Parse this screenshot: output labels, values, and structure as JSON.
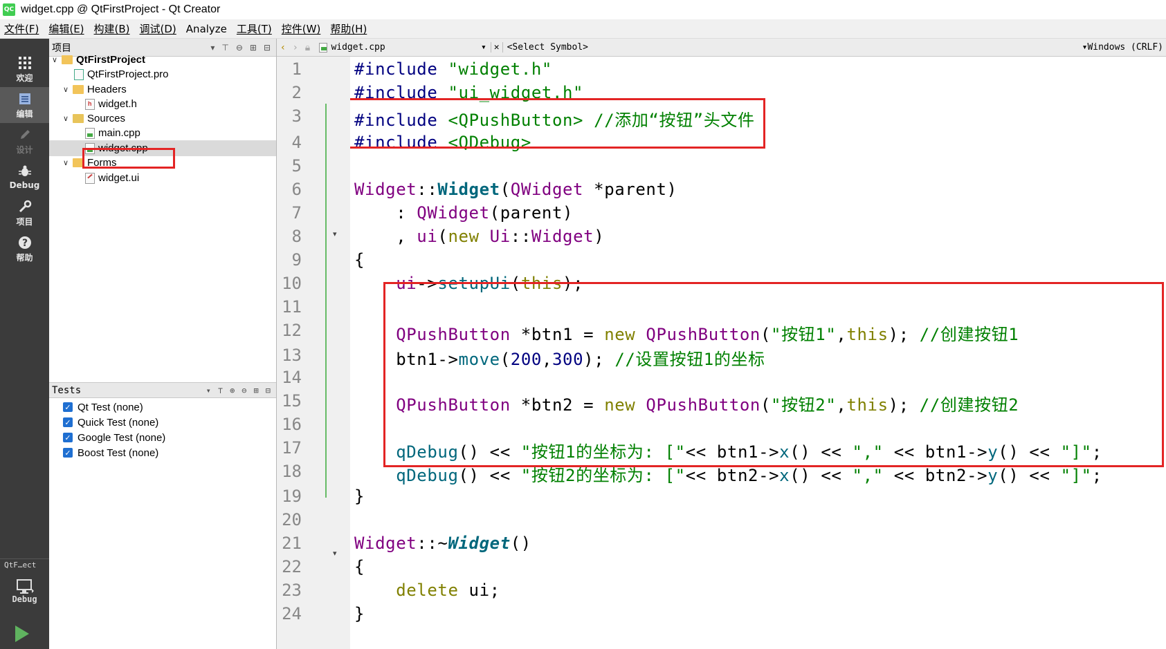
{
  "window": {
    "app_icon": "QC",
    "title": "widget.cpp @ QtFirstProject - Qt Creator"
  },
  "menu": [
    "文件(F)",
    "编辑(E)",
    "构建(B)",
    "调试(D)",
    "Analyze",
    "工具(T)",
    "控件(W)",
    "帮助(H)"
  ],
  "modes": [
    {
      "label": "欢迎",
      "icon": "grid-icon"
    },
    {
      "label": "编辑",
      "icon": "document-icon"
    },
    {
      "label": "设计",
      "icon": "pencil-icon"
    },
    {
      "label": "Debug",
      "icon": "bug-icon"
    },
    {
      "label": "项目",
      "icon": "wrench-icon"
    },
    {
      "label": "帮助",
      "icon": "help-icon"
    }
  ],
  "run_target": {
    "name": "QtF…ect",
    "mode": "Debug"
  },
  "project_pane": {
    "title": "项目",
    "tree": [
      {
        "label": "QtFirstProject",
        "kind": "project-root"
      },
      {
        "label": "QtFirstProject.pro",
        "kind": "pro-file"
      },
      {
        "label": "Headers",
        "kind": "folder"
      },
      {
        "label": "widget.h",
        "kind": "header"
      },
      {
        "label": "Sources",
        "kind": "folder"
      },
      {
        "label": "main.cpp",
        "kind": "cpp"
      },
      {
        "label": "widget.cpp",
        "kind": "cpp"
      },
      {
        "label": "Forms",
        "kind": "folder"
      },
      {
        "label": "widget.ui",
        "kind": "ui"
      }
    ]
  },
  "tests_pane": {
    "title": "Tests",
    "items": [
      "Qt Test (none)",
      "Quick Test (none)",
      "Google Test (none)",
      "Boost Test (none)"
    ]
  },
  "editor": {
    "file": "widget.cpp",
    "symbol": "<Select Symbol>",
    "encoding": "Windows (CRLF)",
    "line_numbers": [
      "1",
      "2",
      "3",
      "4",
      "5",
      "6",
      "7",
      "8",
      "9",
      "10",
      "11",
      "12",
      "13",
      "14",
      "15",
      "16",
      "17",
      "18",
      "19",
      "20",
      "21",
      "22",
      "23",
      "24"
    ],
    "code": {
      "l1_a": "#include",
      "l1_b": "\"widget.h\"",
      "l2_a": "#include",
      "l2_b": "\"ui_widget.h\"",
      "l3_a": "#include",
      "l3_b": "<QPushButton>",
      "l3_c": "//添加“按钮”头文件",
      "l4_a": "#include",
      "l4_b": "<QDebug>",
      "l6_a": "Widget",
      "l6_b": "::",
      "l6_c": "Widget",
      "l6_d": "(",
      "l6_e": "QWidget",
      "l6_f": " *parent)",
      "l7_a": "    : ",
      "l7_b": "QWidget",
      "l7_c": "(parent)",
      "l8_a": "    , ",
      "l8_b": "ui",
      "l8_c": "(",
      "l8_d": "new",
      "l8_e": " Ui",
      "l8_f": "::",
      "l8_g": "Widget",
      "l8_h": ")",
      "l9": "{",
      "l10_a": "    ui",
      "l10_b": "->",
      "l10_c": "setupUi",
      "l10_d": "(",
      "l10_e": "this",
      "l10_f": ");",
      "l12_a": "    QPushButton",
      "l12_b": " *btn1 = ",
      "l12_c": "new",
      "l12_d": " QPushButton",
      "l12_e": "(",
      "l12_f": "\"按钮1\"",
      "l12_g": ",",
      "l12_h": "this",
      "l12_i": "); ",
      "l12_j": "//创建按钮1",
      "l13_a": "    btn1",
      "l13_b": "->",
      "l13_c": "move",
      "l13_d": "(",
      "l13_e": "200",
      "l13_f": ",",
      "l13_g": "300",
      "l13_h": "); ",
      "l13_i": "//设置按钮1的坐标",
      "l15_a": "    QPushButton",
      "l15_b": " *btn2 = ",
      "l15_c": "new",
      "l15_d": " QPushButton",
      "l15_e": "(",
      "l15_f": "\"按钮2\"",
      "l15_g": ",",
      "l15_h": "this",
      "l15_i": "); ",
      "l15_j": "//创建按钮2",
      "l17_a": "    qDebug",
      "l17_b": "() << ",
      "l17_c": "\"按钮1的坐标为: [\"",
      "l17_d": "<< btn1",
      "l17_e": "->",
      "l17_f": "x",
      "l17_g": "() << ",
      "l17_h": "\",\"",
      "l17_i": " << btn1",
      "l17_j": "->",
      "l17_k": "y",
      "l17_l": "() << ",
      "l17_m": "\"]\"",
      "l17_n": ";",
      "l18_a": "    qDebug",
      "l18_b": "() << ",
      "l18_c": "\"按钮2的坐标为: [\"",
      "l18_d": "<< btn2",
      "l18_e": "->",
      "l18_f": "x",
      "l18_g": "() << ",
      "l18_h": "\",\"",
      "l18_i": " << btn2",
      "l18_j": "->",
      "l18_k": "y",
      "l18_l": "() << ",
      "l18_m": "\"]\"",
      "l18_n": ";",
      "l19": "}",
      "l21_a": "Widget",
      "l21_b": "::~",
      "l21_c": "Widget",
      "l21_d": "()",
      "l22": "{",
      "l23_a": "    ",
      "l23_b": "delete",
      "l23_c": " ui;",
      "l24": "}"
    }
  },
  "colors": {
    "highlight_box": "#e32424",
    "keyword": "#808000",
    "preprocessor": "#000080",
    "string": "#008000",
    "class": "#800080",
    "function": "#00677c"
  }
}
